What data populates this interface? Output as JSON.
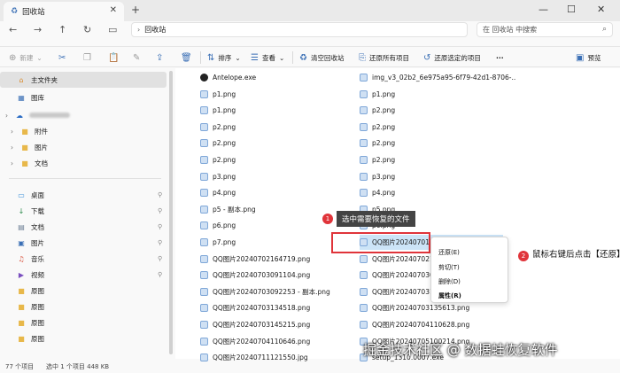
{
  "window": {
    "tab_title": "回收站",
    "minimize": "—",
    "maximize": "☐",
    "close": "✕"
  },
  "address": {
    "path": "回收站",
    "search_placeholder": "在 回收站 中搜索"
  },
  "toolbar": {
    "new_label": "新建",
    "sort_label": "排序",
    "view_label": "查看",
    "empty_bin_label": "清空回收站",
    "restore_all_label": "还原所有项目",
    "restore_selected_label": "还原选定的项目",
    "more_label": "···",
    "preview_label": "预览"
  },
  "sidebar": {
    "home": "主文件夹",
    "gallery": "图库",
    "onedrive": "",
    "od_items": [
      "附件",
      "图片",
      "文档"
    ],
    "quick": [
      "桌面",
      "下载",
      "文档",
      "图片",
      "音乐",
      "视频",
      "原图",
      "原图",
      "原图",
      "原图"
    ]
  },
  "files_left": [
    "Antelope.exe",
    "p1.png",
    "p1.png",
    "p2.png",
    "p2.png",
    "p2.png",
    "p3.png",
    "p4.png",
    "p5 - 副本.png",
    "p6.png",
    "p7.png",
    "QQ图片20240702164719.png",
    "QQ图片20240703091104.png",
    "QQ图片20240703092253 - 副本.png",
    "QQ图片20240703134518.png",
    "QQ图片20240703145215.png",
    "QQ图片20240704110646.png",
    "QQ图片20240711121550.jpg"
  ],
  "files_right": [
    "img_v3_02b2_6e975a95-6f79-42d1-8706-...",
    "p1.png",
    "p2.png",
    "p2.png",
    "p2.png",
    "p2.png",
    "p3.png",
    "p4.png",
    "p5.png",
    "p6.png",
    "QQ图片20240701164014...",
    "QQ图片2024070216484",
    "QQ图片2024070309113",
    "QQ图片20240703133",
    "QQ图片20240703135613.png",
    "QQ图片20240704110628.png",
    "QQ图片20240705100214.png",
    "setup_1310.0007.exe"
  ],
  "callout1": {
    "num": "1",
    "text": "选中需要恢复的文件"
  },
  "callout2": {
    "num": "2",
    "text": "鼠标右键后点击【还原】"
  },
  "context_menu": [
    "还原(E)",
    "剪切(T)",
    "删除(D)",
    "属性(R)"
  ],
  "status": {
    "count": "77 个项目",
    "selected": "选中 1 个项目 448 KB"
  },
  "watermark": "掘金技术社区 @ 数据蛙恢复软件"
}
